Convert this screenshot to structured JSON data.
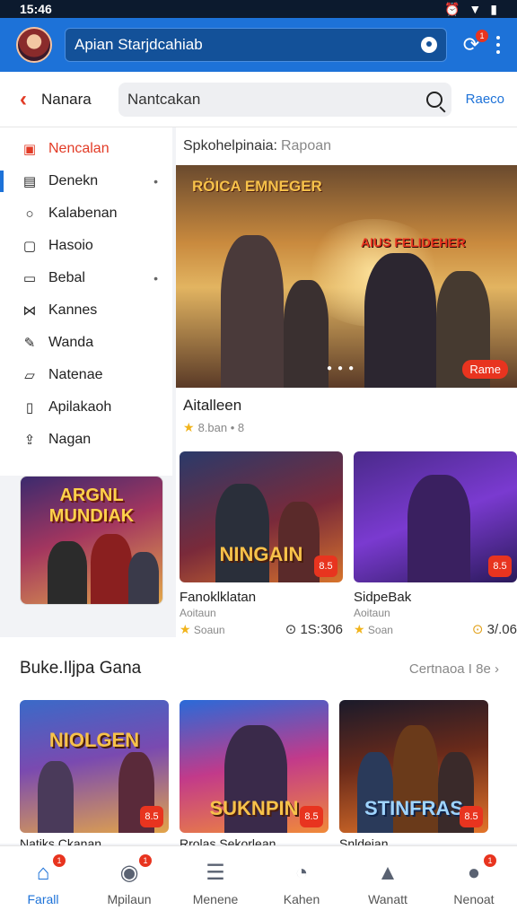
{
  "status": {
    "time": "15:46"
  },
  "topbar": {
    "app_title": "Apian Starjdcahiab"
  },
  "searchbar": {
    "brand": "Nanara",
    "query": "Nantcakan",
    "action": "Raeco"
  },
  "sidebar": {
    "items": [
      {
        "label": "Nencalan",
        "icon": "calendar-icon"
      },
      {
        "label": "Denekn",
        "icon": "document-icon"
      },
      {
        "label": "Kalabenan",
        "icon": "circle-icon"
      },
      {
        "label": "Hasoio",
        "icon": "clipboard-icon"
      },
      {
        "label": "Bebal",
        "icon": "folder-icon"
      },
      {
        "label": "Kannes",
        "icon": "bowtie-icon"
      },
      {
        "label": "Wanda",
        "icon": "edit-icon"
      },
      {
        "label": "Natenae",
        "icon": "chat-icon"
      },
      {
        "label": "Apilakaoh",
        "icon": "file-icon"
      },
      {
        "label": "Nagan",
        "icon": "share-icon"
      }
    ],
    "promo_title": "ARGNL MUNDIAK"
  },
  "main": {
    "breadcrumb": "Spkohelpinaia:",
    "breadcrumb_sub": "Rapoan",
    "hero": {
      "overlay_left": "RÖICA EMNEGER",
      "overlay_right": "AIUS FELIDEHER",
      "tag": "Rame",
      "title": "Aitalleen",
      "rating": "8.ban • 8"
    },
    "cards": [
      {
        "title": "Fanoklklatan",
        "sub": "Aoitaun",
        "rating": "Soaun",
        "count": "1S:306",
        "art": "NINGAIN",
        "corner": "8.5"
      },
      {
        "title": "SidpeBak",
        "sub": "Aoitaun",
        "rating": "Soan",
        "count": "3/.06",
        "art": "",
        "corner": "8.5"
      }
    ]
  },
  "section": {
    "title": "Buke.Iljpa Gana",
    "see_all": "Certnaoa I 8e",
    "tiles": [
      {
        "name": "Natiks Ckanan",
        "art": "NIOLGEN",
        "corner": "8.5"
      },
      {
        "name": "Rrolas Sekorlean",
        "art": "SUKNPIN",
        "corner": "8.5"
      },
      {
        "name": "Snldeian",
        "art": "STINFRAS",
        "corner": "8.5"
      }
    ]
  },
  "bottomnav": [
    {
      "label": "Farall",
      "icon": "home-icon",
      "badge": "1"
    },
    {
      "label": "Mpilaun",
      "icon": "game-icon",
      "badge": "1"
    },
    {
      "label": "Menene",
      "icon": "menu-icon",
      "badge": ""
    },
    {
      "label": "Kahen",
      "icon": "search-icon",
      "badge": ""
    },
    {
      "label": "Wanatt",
      "icon": "explore-icon",
      "badge": ""
    },
    {
      "label": "Nenoat",
      "icon": "profile-icon",
      "badge": "1"
    }
  ]
}
